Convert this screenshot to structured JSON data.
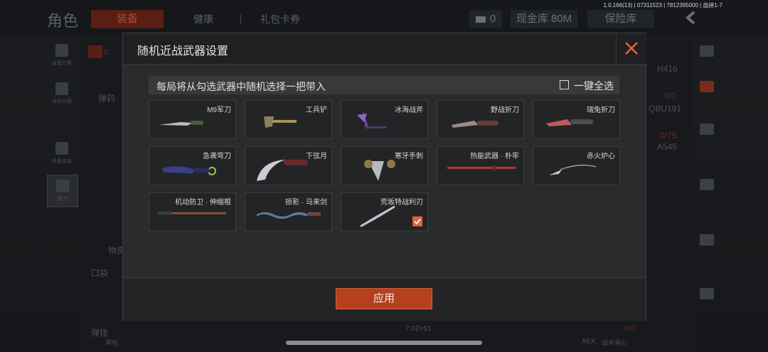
{
  "version": "1.0.166(13) | 07311523 | 7812395000 | 血拼1-7",
  "background": {
    "title": "角色",
    "tabs": [
      "装备",
      "健康",
      "礼包卡券"
    ],
    "tickets": "0",
    "cash": "现金库 80M",
    "vault": "保险库",
    "left_rail": [
      "装备方案",
      "保存方案",
      "装备渲染",
      "能力"
    ],
    "count_0": "0",
    "labels": [
      "弹药",
      "物资",
      "口袋",
      "弹挂",
      "背包"
    ],
    "right_labels": [
      "H416",
      "0/0",
      "QBU191",
      "0/75",
      "A545"
    ],
    "bottom": [
      "7.62×51",
      "0/0",
      "AEK",
      "战术背心",
      "初始防护"
    ]
  },
  "modal": {
    "title": "随机近战武器设置",
    "section_text": "每局将从勾选武器中随机选择一把带入",
    "select_all_label": "一键全选",
    "apply_label": "应用",
    "weapons": [
      {
        "name": "M9军刀",
        "checked": false
      },
      {
        "name": "工兵铲",
        "checked": false
      },
      {
        "name": "冰海战斧",
        "checked": false
      },
      {
        "name": "野战折刀",
        "checked": false
      },
      {
        "name": "瑞兔折刀",
        "checked": false
      },
      {
        "name": "急袭弯刀",
        "checked": false
      },
      {
        "name": "下弦月",
        "checked": false
      },
      {
        "name": "寒牙手刺",
        "checked": false
      },
      {
        "name": "热能武器 · 朴牢",
        "checked": false
      },
      {
        "name": "赤火炉心",
        "checked": false
      },
      {
        "name": "机动防卫 · 伸缩棍",
        "checked": false
      },
      {
        "name": "掠影 · 马来剑",
        "checked": false
      },
      {
        "name": "荒坂特战利刃",
        "checked": true
      }
    ]
  },
  "colors": {
    "accent": "#b4401f",
    "check": "#e0643c",
    "close": "#e0643c"
  },
  "icons": [
    "close-icon",
    "check-icon",
    "back-arrow-icon",
    "ticket-icon"
  ]
}
